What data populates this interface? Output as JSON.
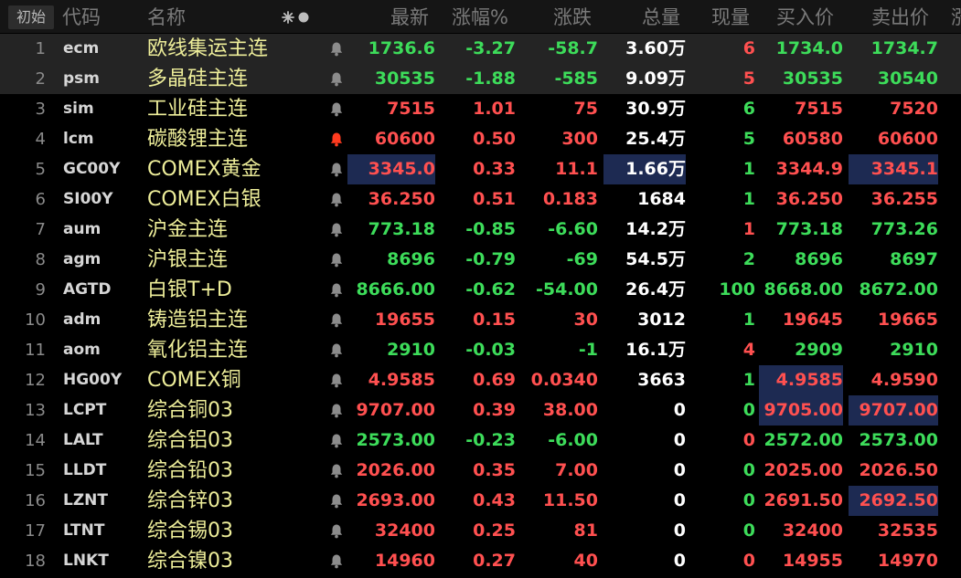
{
  "header": {
    "home_label": "初始",
    "col_code": "代码",
    "col_name": "名称",
    "col_last": "最新",
    "col_pct": "涨幅%",
    "col_chg": "涨跌",
    "col_vol": "总量",
    "col_cur": "现量",
    "col_bid": "买入价",
    "col_ask": "卖出价",
    "col_cut": "涨"
  },
  "colors": {
    "up": "#ff5050",
    "down": "#3ddc5a",
    "name": "#eeee9a",
    "highlight": "#1d2a52",
    "bell_active": "#ff3b1f",
    "bell_inactive": "#8c8c8c"
  },
  "rows": [
    {
      "idx": "1",
      "code": "ecm",
      "name": "欧线集运主连",
      "bell": "inactive",
      "last": "1736.6",
      "pct": "-3.27",
      "chg": "-58.7",
      "vol": "3.60万",
      "cur": "6",
      "bid": "1734.0",
      "ask": "1734.7",
      "dir": "down",
      "cur_dir": "up",
      "bid_dir": "down",
      "ask_dir": "down"
    },
    {
      "idx": "2",
      "code": "psm",
      "name": "多晶硅主连",
      "bell": "inactive",
      "last": "30535",
      "pct": "-1.88",
      "chg": "-585",
      "vol": "9.09万",
      "cur": "5",
      "bid": "30535",
      "ask": "30540",
      "dir": "down",
      "cur_dir": "up",
      "bid_dir": "down",
      "ask_dir": "down"
    },
    {
      "idx": "3",
      "code": "sim",
      "name": "工业硅主连",
      "bell": "inactive",
      "last": "7515",
      "pct": "1.01",
      "chg": "75",
      "vol": "30.9万",
      "cur": "6",
      "bid": "7515",
      "ask": "7520",
      "dir": "up",
      "cur_dir": "down",
      "bid_dir": "up",
      "ask_dir": "up"
    },
    {
      "idx": "4",
      "code": "lcm",
      "name": "碳酸锂主连",
      "bell": "active",
      "last": "60600",
      "pct": "0.50",
      "chg": "300",
      "vol": "25.4万",
      "cur": "5",
      "bid": "60580",
      "ask": "60600",
      "dir": "up",
      "cur_dir": "down",
      "bid_dir": "up",
      "ask_dir": "up"
    },
    {
      "idx": "5",
      "code": "GC00Y",
      "name": "COMEX黄金",
      "bell": "inactive",
      "last": "3345.0",
      "pct": "0.33",
      "chg": "11.1",
      "vol": "1.66万",
      "cur": "1",
      "bid": "3344.9",
      "ask": "3345.1",
      "dir": "up",
      "cur_dir": "down",
      "bid_dir": "up",
      "ask_dir": "up"
    },
    {
      "idx": "6",
      "code": "SI00Y",
      "name": "COMEX白银",
      "bell": "inactive",
      "last": "36.250",
      "pct": "0.51",
      "chg": "0.183",
      "vol": "1684",
      "cur": "1",
      "bid": "36.250",
      "ask": "36.255",
      "dir": "up",
      "cur_dir": "down",
      "bid_dir": "up",
      "ask_dir": "up"
    },
    {
      "idx": "7",
      "code": "aum",
      "name": "沪金主连",
      "bell": "inactive",
      "last": "773.18",
      "pct": "-0.85",
      "chg": "-6.60",
      "vol": "14.2万",
      "cur": "1",
      "bid": "773.18",
      "ask": "773.26",
      "dir": "down",
      "cur_dir": "up",
      "bid_dir": "down",
      "ask_dir": "down"
    },
    {
      "idx": "8",
      "code": "agm",
      "name": "沪银主连",
      "bell": "inactive",
      "last": "8696",
      "pct": "-0.79",
      "chg": "-69",
      "vol": "54.5万",
      "cur": "2",
      "bid": "8696",
      "ask": "8697",
      "dir": "down",
      "cur_dir": "down",
      "bid_dir": "down",
      "ask_dir": "down"
    },
    {
      "idx": "9",
      "code": "AGTD",
      "name": "白银T+D",
      "bell": "inactive",
      "last": "8666.00",
      "pct": "-0.62",
      "chg": "-54.00",
      "vol": "26.4万",
      "cur": "100",
      "bid": "8668.00",
      "ask": "8672.00",
      "dir": "down",
      "cur_dir": "down",
      "bid_dir": "down",
      "ask_dir": "down"
    },
    {
      "idx": "10",
      "code": "adm",
      "name": "铸造铝主连",
      "bell": "inactive",
      "last": "19655",
      "pct": "0.15",
      "chg": "30",
      "vol": "3012",
      "cur": "1",
      "bid": "19645",
      "ask": "19665",
      "dir": "up",
      "cur_dir": "down",
      "bid_dir": "up",
      "ask_dir": "up"
    },
    {
      "idx": "11",
      "code": "aom",
      "name": "氧化铝主连",
      "bell": "inactive",
      "last": "2910",
      "pct": "-0.03",
      "chg": "-1",
      "vol": "16.1万",
      "cur": "4",
      "bid": "2909",
      "ask": "2910",
      "dir": "down",
      "cur_dir": "up",
      "bid_dir": "down",
      "ask_dir": "down"
    },
    {
      "idx": "12",
      "code": "HG00Y",
      "name": "COMEX铜",
      "bell": "inactive",
      "last": "4.9585",
      "pct": "0.69",
      "chg": "0.0340",
      "vol": "3663",
      "cur": "1",
      "bid": "4.9585",
      "ask": "4.9590",
      "dir": "up",
      "cur_dir": "down",
      "bid_dir": "up",
      "ask_dir": "up"
    },
    {
      "idx": "13",
      "code": "LCPT",
      "name": "综合铜03",
      "bell": "inactive",
      "last": "9707.00",
      "pct": "0.39",
      "chg": "38.00",
      "vol": "0",
      "cur": "0",
      "bid": "9705.00",
      "ask": "9707.00",
      "dir": "up",
      "cur_dir": "down",
      "bid_dir": "up",
      "ask_dir": "up"
    },
    {
      "idx": "14",
      "code": "LALT",
      "name": "综合铝03",
      "bell": "inactive",
      "last": "2573.00",
      "pct": "-0.23",
      "chg": "-6.00",
      "vol": "0",
      "cur": "0",
      "bid": "2572.00",
      "ask": "2573.00",
      "dir": "down",
      "cur_dir": "up",
      "bid_dir": "down",
      "ask_dir": "down"
    },
    {
      "idx": "15",
      "code": "LLDT",
      "name": "综合铅03",
      "bell": "inactive",
      "last": "2026.00",
      "pct": "0.35",
      "chg": "7.00",
      "vol": "0",
      "cur": "0",
      "bid": "2025.00",
      "ask": "2026.50",
      "dir": "up",
      "cur_dir": "down",
      "bid_dir": "up",
      "ask_dir": "up"
    },
    {
      "idx": "16",
      "code": "LZNT",
      "name": "综合锌03",
      "bell": "inactive",
      "last": "2693.00",
      "pct": "0.43",
      "chg": "11.50",
      "vol": "0",
      "cur": "0",
      "bid": "2691.50",
      "ask": "2692.50",
      "dir": "up",
      "cur_dir": "down",
      "bid_dir": "up",
      "ask_dir": "up"
    },
    {
      "idx": "17",
      "code": "LTNT",
      "name": "综合锡03",
      "bell": "inactive",
      "last": "32400",
      "pct": "0.25",
      "chg": "81",
      "vol": "0",
      "cur": "0",
      "bid": "32400",
      "ask": "32535",
      "dir": "up",
      "cur_dir": "down",
      "bid_dir": "up",
      "ask_dir": "up"
    },
    {
      "idx": "18",
      "code": "LNKT",
      "name": "综合镍03",
      "bell": "inactive",
      "last": "14960",
      "pct": "0.27",
      "chg": "40",
      "vol": "0",
      "cur": "0",
      "bid": "14955",
      "ask": "14970",
      "dir": "up",
      "cur_dir": "up",
      "bid_dir": "up",
      "ask_dir": "up"
    }
  ]
}
